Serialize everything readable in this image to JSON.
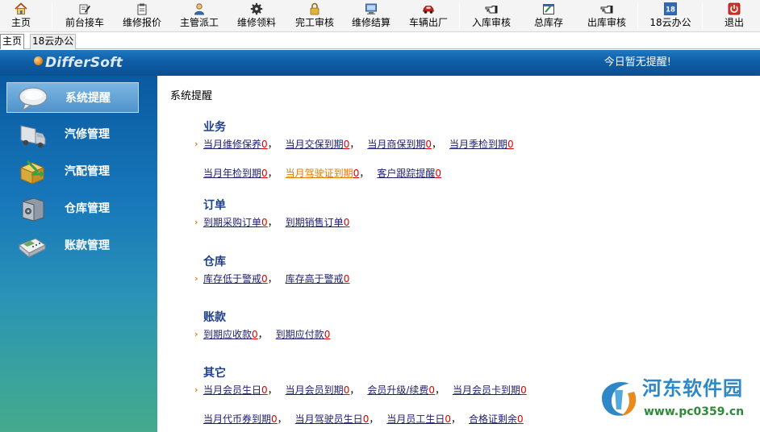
{
  "toolbar": {
    "items": [
      {
        "label": "主页",
        "icon": "home-icon"
      },
      {
        "label": "前台接车",
        "icon": "car-reception-icon"
      },
      {
        "label": "维修报价",
        "icon": "quote-icon"
      },
      {
        "label": "主管派工",
        "icon": "dispatch-icon"
      },
      {
        "label": "维修领料",
        "icon": "gear-icon"
      },
      {
        "label": "完工审核",
        "icon": "lock-icon"
      },
      {
        "label": "维修结算",
        "icon": "computer-icon"
      },
      {
        "label": "车辆出厂",
        "icon": "car-exit-icon"
      },
      {
        "label": "入库审核",
        "icon": "pointing-hand-icon"
      },
      {
        "label": "总库存",
        "icon": "inventory-icon"
      },
      {
        "label": "出库审核",
        "icon": "pointing-hand-icon"
      },
      {
        "label": "18云办公",
        "icon": "calendar-icon",
        "icon_text": "18"
      },
      {
        "label": "退出",
        "icon": "exit-icon"
      }
    ]
  },
  "tabs": [
    {
      "label": "主页",
      "active": true
    },
    {
      "label": "18云办公",
      "active": false
    }
  ],
  "header": {
    "logo_text": "DifferSoft",
    "reminder": "今日暂无提醒!"
  },
  "sidebar": {
    "items": [
      {
        "label": "系统提醒",
        "icon": "speech-bubble-icon",
        "active": true
      },
      {
        "label": "汽修管理",
        "icon": "truck-icon",
        "active": false
      },
      {
        "label": "汽配管理",
        "icon": "box-icon",
        "active": false
      },
      {
        "label": "仓库管理",
        "icon": "safe-icon",
        "active": false
      },
      {
        "label": "账款管理",
        "icon": "cash-register-icon",
        "active": false
      }
    ]
  },
  "main": {
    "title": "系统提醒",
    "sections": [
      {
        "title": "业务",
        "rows": [
          [
            {
              "label": "当月维修保养",
              "count": "0"
            },
            {
              "label": "当月交保到期",
              "count": "0"
            },
            {
              "label": "当月商保到期",
              "count": "0"
            },
            {
              "label": "当月季检到期",
              "count": "0"
            }
          ],
          [
            {
              "label": "当月年检到期",
              "count": "0"
            },
            {
              "label": "当月驾驶证到期",
              "count": "0",
              "highlight": true
            },
            {
              "label": "客户跟踪提醒",
              "count": "0"
            }
          ]
        ]
      },
      {
        "title": "订单",
        "rows": [
          [
            {
              "label": "到期采购订单",
              "count": "0"
            },
            {
              "label": "到期销售订单",
              "count": "0"
            }
          ]
        ]
      },
      {
        "title": "仓库",
        "rows": [
          [
            {
              "label": "库存低于警戒",
              "count": "0"
            },
            {
              "label": "库存高于警戒",
              "count": "0"
            }
          ]
        ]
      },
      {
        "title": "账款",
        "rows": [
          [
            {
              "label": "到期应收款",
              "count": "0"
            },
            {
              "label": "到期应付款",
              "count": "0"
            }
          ]
        ]
      },
      {
        "title": "其它",
        "rows": [
          [
            {
              "label": "当月会员生日",
              "count": "0"
            },
            {
              "label": "当月会员到期",
              "count": "0"
            },
            {
              "label": "会员升级/续费",
              "count": "0"
            },
            {
              "label": "当月会员卡到期",
              "count": "0"
            }
          ],
          [
            {
              "label": "当月代币券到期",
              "count": "0"
            },
            {
              "label": "当月驾驶员生日",
              "count": "0"
            },
            {
              "label": "当月员工生日",
              "count": "0"
            },
            {
              "label": "合格证剩余",
              "count": "0"
            }
          ]
        ]
      }
    ]
  },
  "watermark": {
    "name": "河东软件园",
    "url": "www.pc0359.cn"
  },
  "colors": {
    "header_blue": "#0e5ea6",
    "section_title": "#1f3f8f",
    "link": "#1d1d6e",
    "count_red": "#e00000",
    "highlight_orange": "#e57b00"
  }
}
